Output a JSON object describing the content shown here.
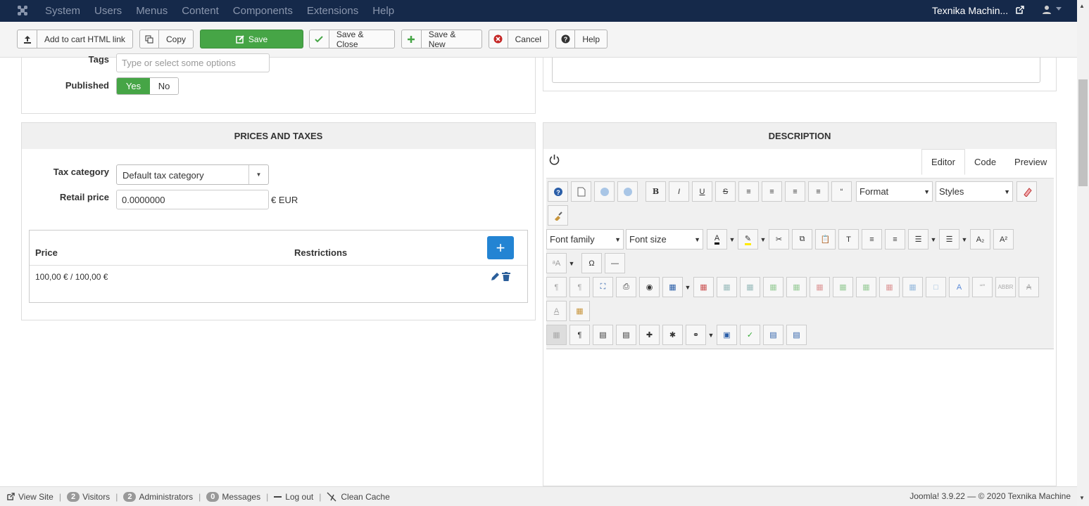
{
  "navbar": {
    "menu": [
      "System",
      "Users",
      "Menus",
      "Content",
      "Components",
      "Extensions",
      "Help"
    ],
    "site_name": "Texnika Machin..."
  },
  "toolbar": {
    "add_to_cart": "Add to cart HTML link",
    "copy": "Copy",
    "save": "Save",
    "save_close": "Save & Close",
    "save_new": "Save & New",
    "cancel": "Cancel",
    "help": "Help"
  },
  "form_top": {
    "tags_label": "Tags",
    "tags_placeholder": "Type or select some options",
    "published_label": "Published",
    "yes": "Yes",
    "no": "No"
  },
  "prices": {
    "title": "PRICES AND TAXES",
    "tax_label": "Tax category",
    "tax_value": "Default tax category",
    "retail_label": "Retail price",
    "retail_value": "0.0000000",
    "currency": "€ EUR",
    "col_price": "Price",
    "col_restrictions": "Restrictions",
    "row_price": "100,00 € / 100,00 €",
    "add_symbol": "+"
  },
  "description": {
    "title": "DESCRIPTION",
    "tabs": [
      "Editor",
      "Code",
      "Preview"
    ],
    "active_tab": "Editor",
    "format": "Format",
    "styles": "Styles",
    "font_family": "Font family",
    "font_size": "Font size"
  },
  "footer": {
    "view_site": "View Site",
    "visitors_count": "2",
    "visitors": "Visitors",
    "admins_count": "2",
    "admins": "Administrators",
    "messages_count": "0",
    "messages": "Messages",
    "logout": "Log out",
    "clean_cache": "Clean Cache",
    "version": "Joomla! 3.9.22 — © 2020 Texnika Machine"
  },
  "colors": {
    "navbar": "#15294a",
    "save_green": "#46a546",
    "add_blue": "#2384d3"
  }
}
